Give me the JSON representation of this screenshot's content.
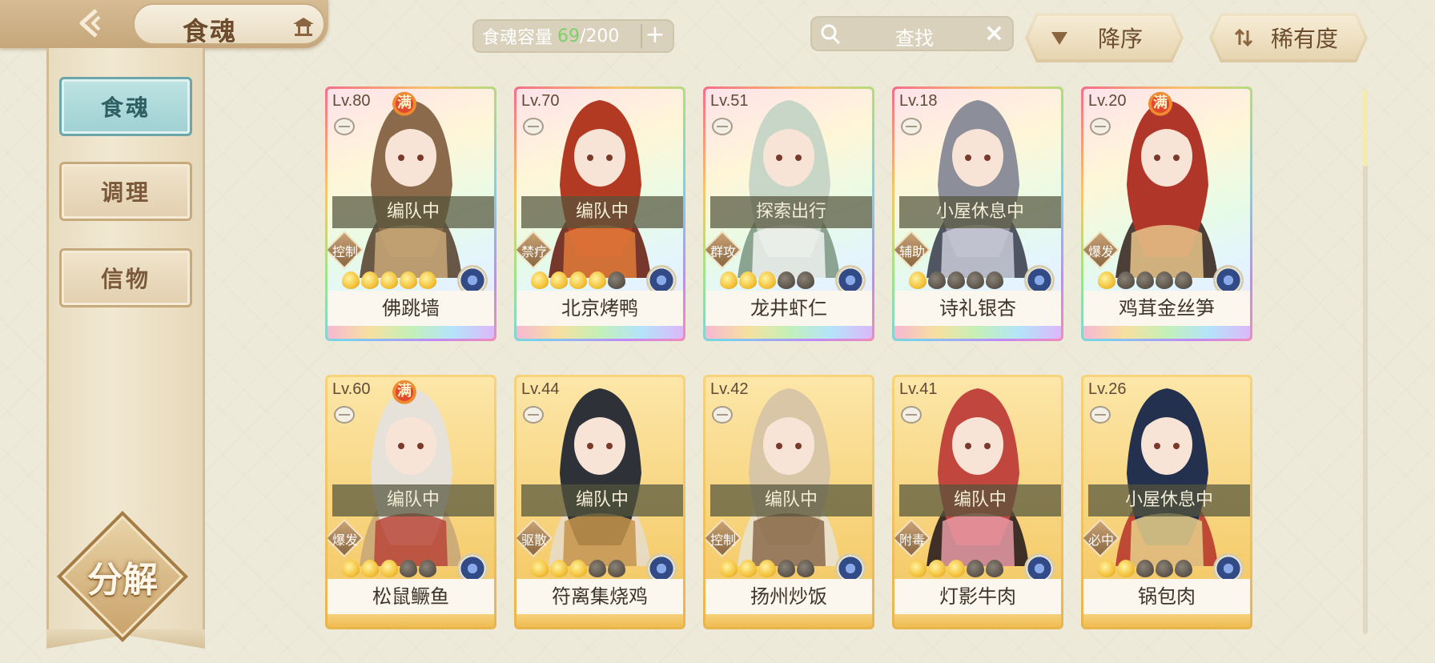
{
  "header": {
    "title": "食魂",
    "back_icon": "back-arrow-icon",
    "home_icon": "pavilion-icon"
  },
  "sidebar": {
    "tabs": [
      {
        "label": "食魂",
        "active": true
      },
      {
        "label": "调理",
        "active": false
      },
      {
        "label": "信物",
        "active": false
      }
    ],
    "decompose_label": "分解"
  },
  "toolbar": {
    "capacity_label": "食魂容量",
    "capacity_current": "69",
    "capacity_sep": "/",
    "capacity_max": "200",
    "add_icon": "+",
    "search_placeholder": "查找",
    "clear_icon": "×",
    "sort_order_label": "降序",
    "sort_key_label": "稀有度"
  },
  "colors": {
    "accent_teal": "#9fd0d2",
    "star_on": "#f4c23a",
    "star_off": "#5a5248",
    "full_badge": "#e24a2e",
    "capacity_green": "#7fcf6a"
  },
  "cards": [
    {
      "level": "Lv.80",
      "full": true,
      "full_label": "满",
      "status": "编队中",
      "role": "控制",
      "stars": 5,
      "max_stars": 5,
      "name": "佛跳墙",
      "frame": "rainbow"
    },
    {
      "level": "Lv.70",
      "full": false,
      "full_label": "",
      "status": "编队中",
      "role": "禁疗",
      "stars": 4,
      "max_stars": 5,
      "name": "北京烤鸭",
      "frame": "rainbow"
    },
    {
      "level": "Lv.51",
      "full": false,
      "full_label": "",
      "status": "探索出行",
      "role": "群攻",
      "stars": 3,
      "max_stars": 5,
      "name": "龙井虾仁",
      "frame": "rainbow"
    },
    {
      "level": "Lv.18",
      "full": false,
      "full_label": "",
      "status": "小屋休息中",
      "role": "辅助",
      "stars": 1,
      "max_stars": 5,
      "name": "诗礼银杏",
      "frame": "rainbow"
    },
    {
      "level": "Lv.20",
      "full": true,
      "full_label": "满",
      "status": "",
      "role": "爆发",
      "stars": 1,
      "max_stars": 5,
      "name": "鸡茸金丝笋",
      "frame": "rainbow"
    },
    {
      "level": "Lv.60",
      "full": true,
      "full_label": "满",
      "status": "编队中",
      "role": "爆发",
      "stars": 3,
      "max_stars": 5,
      "name": "松鼠鳜鱼",
      "frame": "gold"
    },
    {
      "level": "Lv.44",
      "full": false,
      "full_label": "",
      "status": "编队中",
      "role": "驱散",
      "stars": 3,
      "max_stars": 5,
      "name": "符离集烧鸡",
      "frame": "gold"
    },
    {
      "level": "Lv.42",
      "full": false,
      "full_label": "",
      "status": "编队中",
      "role": "控制",
      "stars": 3,
      "max_stars": 5,
      "name": "扬州炒饭",
      "frame": "gold"
    },
    {
      "level": "Lv.41",
      "full": false,
      "full_label": "",
      "status": "编队中",
      "role": "附毒",
      "stars": 3,
      "max_stars": 5,
      "name": "灯影牛肉",
      "frame": "gold"
    },
    {
      "level": "Lv.26",
      "full": false,
      "full_label": "",
      "status": "小屋休息中",
      "role": "必中",
      "stars": 2,
      "max_stars": 5,
      "name": "锅包肉",
      "frame": "gold"
    }
  ],
  "scroll_position": 0.0
}
